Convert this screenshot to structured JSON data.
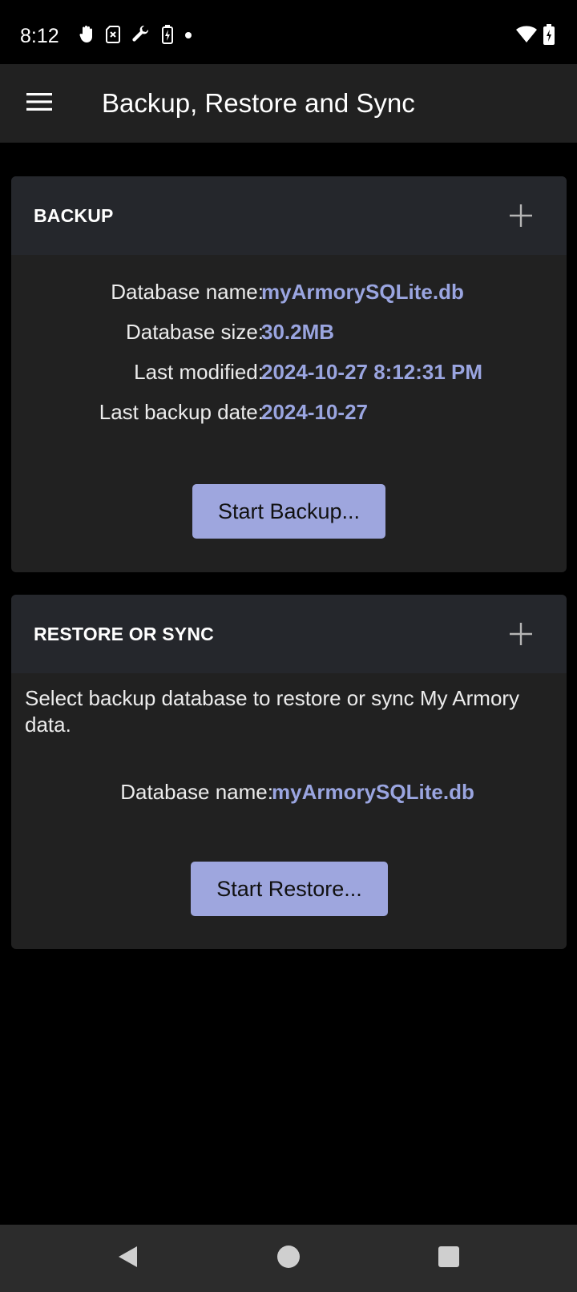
{
  "status_bar": {
    "time": "8:12",
    "left_icons": [
      "hand-icon",
      "sim-card-icon",
      "wrench-icon",
      "battery-saver-icon",
      "dot-icon"
    ],
    "right_icons": [
      "wifi-icon",
      "battery-icon"
    ]
  },
  "app_bar": {
    "menu_icon": "hamburger-menu-icon",
    "title": "Backup, Restore and Sync"
  },
  "backup_card": {
    "title": "BACKUP",
    "expand_icon": "plus-icon",
    "rows": [
      {
        "label": "Database name:",
        "value": "myArmorySQLite.db"
      },
      {
        "label": "Database size:",
        "value": "30.2MB"
      },
      {
        "label": "Last modified:",
        "value": "2024-10-27 8:12:31 PM"
      },
      {
        "label": "Last backup date:",
        "value": "2024-10-27"
      }
    ],
    "button_label": "Start Backup..."
  },
  "restore_card": {
    "title": "RESTORE OR SYNC",
    "expand_icon": "plus-icon",
    "description": "Select backup database to restore or sync My Armory data.",
    "row": {
      "label": "Database name:",
      "value": "myArmorySQLite.db"
    },
    "button_label": "Start Restore..."
  },
  "nav_bar": {
    "buttons": [
      "back-icon",
      "home-icon",
      "recents-icon"
    ]
  },
  "colors": {
    "accent": "#9aa5e0",
    "button_bg": "#9ea6de",
    "card_bg": "#212121",
    "card_header_bg": "#25272c",
    "page_bg": "#000000"
  }
}
